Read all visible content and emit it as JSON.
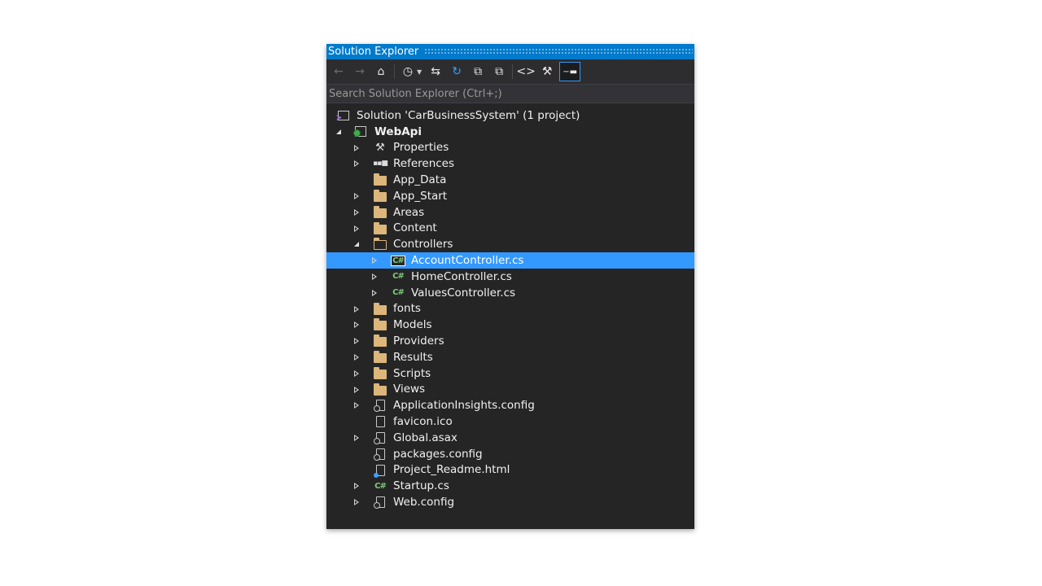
{
  "panel": {
    "title": "Solution Explorer",
    "search_placeholder": "Search Solution Explorer (Ctrl+;)"
  },
  "toolbar": {
    "buttons": [
      {
        "name": "back-icon",
        "glyph": "←"
      },
      {
        "name": "forward-icon",
        "glyph": "→"
      },
      {
        "name": "home-icon",
        "glyph": "⌂"
      },
      {
        "name": "pending-changes-icon",
        "glyph": "◷"
      },
      {
        "name": "sync-icon",
        "glyph": "⇆"
      },
      {
        "name": "refresh-icon",
        "glyph": "↻"
      },
      {
        "name": "collapse-all-icon",
        "glyph": "⧉"
      },
      {
        "name": "show-all-files-icon",
        "glyph": "⧉"
      },
      {
        "name": "view-code-icon",
        "glyph": "<>"
      },
      {
        "name": "properties-icon",
        "glyph": "⚒"
      },
      {
        "name": "preview-icon",
        "glyph": "−▬"
      }
    ]
  },
  "tree": [
    {
      "label": "Solution 'CarBusinessSystem' (1 project)",
      "icon": "solution-icon",
      "level": 0,
      "expander": "none"
    },
    {
      "label": "WebApi",
      "icon": "web-project-icon",
      "level": 0,
      "expander": "open",
      "bold": true
    },
    {
      "label": "Properties",
      "icon": "wrench-icon",
      "level": 1,
      "expander": "closed"
    },
    {
      "label": "References",
      "icon": "references-icon",
      "level": 1,
      "expander": "closed"
    },
    {
      "label": "App_Data",
      "icon": "folder-icon",
      "level": 1,
      "expander": "none"
    },
    {
      "label": "App_Start",
      "icon": "folder-icon",
      "level": 1,
      "expander": "closed"
    },
    {
      "label": "Areas",
      "icon": "folder-icon",
      "level": 1,
      "expander": "closed"
    },
    {
      "label": "Content",
      "icon": "folder-icon",
      "level": 1,
      "expander": "closed"
    },
    {
      "label": "Controllers",
      "icon": "folder-open-icon",
      "level": 1,
      "expander": "open"
    },
    {
      "label": "AccountController.cs",
      "icon": "csharp-file-icon",
      "level": 2,
      "expander": "closed",
      "selected": true
    },
    {
      "label": "HomeController.cs",
      "icon": "csharp-file-icon",
      "level": 2,
      "expander": "closed"
    },
    {
      "label": "ValuesController.cs",
      "icon": "csharp-file-icon",
      "level": 2,
      "expander": "closed"
    },
    {
      "label": "fonts",
      "icon": "folder-icon",
      "level": 1,
      "expander": "closed"
    },
    {
      "label": "Models",
      "icon": "folder-icon",
      "level": 1,
      "expander": "closed"
    },
    {
      "label": "Providers",
      "icon": "folder-icon",
      "level": 1,
      "expander": "closed"
    },
    {
      "label": "Results",
      "icon": "folder-icon",
      "level": 1,
      "expander": "closed"
    },
    {
      "label": "Scripts",
      "icon": "folder-icon",
      "level": 1,
      "expander": "closed"
    },
    {
      "label": "Views",
      "icon": "folder-icon",
      "level": 1,
      "expander": "closed"
    },
    {
      "label": "ApplicationInsights.config",
      "icon": "config-file-icon",
      "level": 1,
      "expander": "closed"
    },
    {
      "label": "favicon.ico",
      "icon": "image-file-icon",
      "level": 1,
      "expander": "none"
    },
    {
      "label": "Global.asax",
      "icon": "asax-file-icon",
      "level": 1,
      "expander": "closed"
    },
    {
      "label": "packages.config",
      "icon": "config-file-icon",
      "level": 1,
      "expander": "none"
    },
    {
      "label": "Project_Readme.html",
      "icon": "html-file-icon",
      "level": 1,
      "expander": "none"
    },
    {
      "label": "Startup.cs",
      "icon": "csharp-file-icon",
      "level": 1,
      "expander": "closed"
    },
    {
      "label": "Web.config",
      "icon": "config-file-icon",
      "level": 1,
      "expander": "closed"
    }
  ]
}
